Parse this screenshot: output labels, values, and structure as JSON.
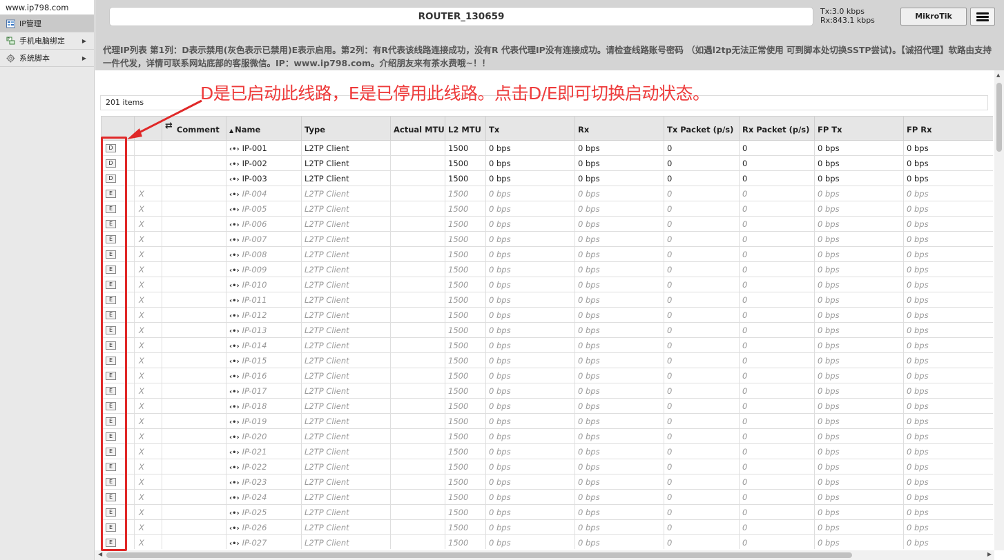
{
  "sidebar": {
    "site": "www.ip798.com",
    "items": [
      {
        "label": "IP管理",
        "icon": "ip-manage-icon",
        "active": true
      },
      {
        "label": "手机电脑绑定",
        "icon": "device-bind-icon",
        "arrow": "▶"
      },
      {
        "label": "系统脚本",
        "icon": "script-gear-icon",
        "arrow": "▶"
      }
    ]
  },
  "header": {
    "title": "ROUTER_130659",
    "tx": "Tx:3.0 kbps",
    "rx": "Rx:843.1 kbps",
    "brand_button": "MikroTik"
  },
  "notice": "代理IP列表 第1列：D表示禁用(灰色表示已禁用)E表示启用。第2列：有R代表该线路连接成功，没有R 代表代理IP没有连接成功。请检查线路账号密码 （如遇l2tp无法正常使用 可到脚本处切换SSTP尝试)。【诚招代理】软路由支持一件代发，详情可联系网站底部的客服微信。IP：www.ip798.com。介绍朋友来有茶水费哦~！！",
  "items_count": "201 items",
  "annotation": "D是已启动此线路，E是已停用此线路。点击D/E即可切换启动状态。",
  "colors": {
    "annotation": "#ee3b3b",
    "highlight_box": "#e02828"
  },
  "table": {
    "headers": {
      "toggle": "",
      "status": "",
      "comment": "Comment",
      "name": "Name",
      "type": "Type",
      "actual_mtu": "Actual MTU",
      "l2_mtu": "L2 MTU",
      "tx": "Tx",
      "rx": "Rx",
      "tx_packet": "Tx Packet (p/s)",
      "rx_packet": "Rx Packet (p/s)",
      "fp_tx": "FP Tx",
      "fp_rx": "FP Rx"
    },
    "sort_indicator": "▲",
    "comment_icon": "comment-toggle-icon",
    "rows": [
      {
        "toggle": "D",
        "status": "",
        "comment": "",
        "name": "IP-001",
        "type": "L2TP Client",
        "actual_mtu": "",
        "l2_mtu": "1500",
        "tx": "0 bps",
        "rx": "0 bps",
        "tx_packet": "0",
        "rx_packet": "0",
        "fp_tx": "0 bps",
        "fp_rx": "0 bps",
        "disabled": false
      },
      {
        "toggle": "D",
        "status": "",
        "comment": "",
        "name": "IP-002",
        "type": "L2TP Client",
        "actual_mtu": "",
        "l2_mtu": "1500",
        "tx": "0 bps",
        "rx": "0 bps",
        "tx_packet": "0",
        "rx_packet": "0",
        "fp_tx": "0 bps",
        "fp_rx": "0 bps",
        "disabled": false
      },
      {
        "toggle": "D",
        "status": "",
        "comment": "",
        "name": "IP-003",
        "type": "L2TP Client",
        "actual_mtu": "",
        "l2_mtu": "1500",
        "tx": "0 bps",
        "rx": "0 bps",
        "tx_packet": "0",
        "rx_packet": "0",
        "fp_tx": "0 bps",
        "fp_rx": "0 bps",
        "disabled": false
      },
      {
        "toggle": "E",
        "status": "X",
        "comment": "",
        "name": "IP-004",
        "type": "L2TP Client",
        "actual_mtu": "",
        "l2_mtu": "1500",
        "tx": "0 bps",
        "rx": "0 bps",
        "tx_packet": "0",
        "rx_packet": "0",
        "fp_tx": "0 bps",
        "fp_rx": "0 bps",
        "disabled": true
      },
      {
        "toggle": "E",
        "status": "X",
        "comment": "",
        "name": "IP-005",
        "type": "L2TP Client",
        "actual_mtu": "",
        "l2_mtu": "1500",
        "tx": "0 bps",
        "rx": "0 bps",
        "tx_packet": "0",
        "rx_packet": "0",
        "fp_tx": "0 bps",
        "fp_rx": "0 bps",
        "disabled": true
      },
      {
        "toggle": "E",
        "status": "X",
        "comment": "",
        "name": "IP-006",
        "type": "L2TP Client",
        "actual_mtu": "",
        "l2_mtu": "1500",
        "tx": "0 bps",
        "rx": "0 bps",
        "tx_packet": "0",
        "rx_packet": "0",
        "fp_tx": "0 bps",
        "fp_rx": "0 bps",
        "disabled": true
      },
      {
        "toggle": "E",
        "status": "X",
        "comment": "",
        "name": "IP-007",
        "type": "L2TP Client",
        "actual_mtu": "",
        "l2_mtu": "1500",
        "tx": "0 bps",
        "rx": "0 bps",
        "tx_packet": "0",
        "rx_packet": "0",
        "fp_tx": "0 bps",
        "fp_rx": "0 bps",
        "disabled": true
      },
      {
        "toggle": "E",
        "status": "X",
        "comment": "",
        "name": "IP-008",
        "type": "L2TP Client",
        "actual_mtu": "",
        "l2_mtu": "1500",
        "tx": "0 bps",
        "rx": "0 bps",
        "tx_packet": "0",
        "rx_packet": "0",
        "fp_tx": "0 bps",
        "fp_rx": "0 bps",
        "disabled": true
      },
      {
        "toggle": "E",
        "status": "X",
        "comment": "",
        "name": "IP-009",
        "type": "L2TP Client",
        "actual_mtu": "",
        "l2_mtu": "1500",
        "tx": "0 bps",
        "rx": "0 bps",
        "tx_packet": "0",
        "rx_packet": "0",
        "fp_tx": "0 bps",
        "fp_rx": "0 bps",
        "disabled": true
      },
      {
        "toggle": "E",
        "status": "X",
        "comment": "",
        "name": "IP-010",
        "type": "L2TP Client",
        "actual_mtu": "",
        "l2_mtu": "1500",
        "tx": "0 bps",
        "rx": "0 bps",
        "tx_packet": "0",
        "rx_packet": "0",
        "fp_tx": "0 bps",
        "fp_rx": "0 bps",
        "disabled": true
      },
      {
        "toggle": "E",
        "status": "X",
        "comment": "",
        "name": "IP-011",
        "type": "L2TP Client",
        "actual_mtu": "",
        "l2_mtu": "1500",
        "tx": "0 bps",
        "rx": "0 bps",
        "tx_packet": "0",
        "rx_packet": "0",
        "fp_tx": "0 bps",
        "fp_rx": "0 bps",
        "disabled": true
      },
      {
        "toggle": "E",
        "status": "X",
        "comment": "",
        "name": "IP-012",
        "type": "L2TP Client",
        "actual_mtu": "",
        "l2_mtu": "1500",
        "tx": "0 bps",
        "rx": "0 bps",
        "tx_packet": "0",
        "rx_packet": "0",
        "fp_tx": "0 bps",
        "fp_rx": "0 bps",
        "disabled": true
      },
      {
        "toggle": "E",
        "status": "X",
        "comment": "",
        "name": "IP-013",
        "type": "L2TP Client",
        "actual_mtu": "",
        "l2_mtu": "1500",
        "tx": "0 bps",
        "rx": "0 bps",
        "tx_packet": "0",
        "rx_packet": "0",
        "fp_tx": "0 bps",
        "fp_rx": "0 bps",
        "disabled": true
      },
      {
        "toggle": "E",
        "status": "X",
        "comment": "",
        "name": "IP-014",
        "type": "L2TP Client",
        "actual_mtu": "",
        "l2_mtu": "1500",
        "tx": "0 bps",
        "rx": "0 bps",
        "tx_packet": "0",
        "rx_packet": "0",
        "fp_tx": "0 bps",
        "fp_rx": "0 bps",
        "disabled": true
      },
      {
        "toggle": "E",
        "status": "X",
        "comment": "",
        "name": "IP-015",
        "type": "L2TP Client",
        "actual_mtu": "",
        "l2_mtu": "1500",
        "tx": "0 bps",
        "rx": "0 bps",
        "tx_packet": "0",
        "rx_packet": "0",
        "fp_tx": "0 bps",
        "fp_rx": "0 bps",
        "disabled": true
      },
      {
        "toggle": "E",
        "status": "X",
        "comment": "",
        "name": "IP-016",
        "type": "L2TP Client",
        "actual_mtu": "",
        "l2_mtu": "1500",
        "tx": "0 bps",
        "rx": "0 bps",
        "tx_packet": "0",
        "rx_packet": "0",
        "fp_tx": "0 bps",
        "fp_rx": "0 bps",
        "disabled": true
      },
      {
        "toggle": "E",
        "status": "X",
        "comment": "",
        "name": "IP-017",
        "type": "L2TP Client",
        "actual_mtu": "",
        "l2_mtu": "1500",
        "tx": "0 bps",
        "rx": "0 bps",
        "tx_packet": "0",
        "rx_packet": "0",
        "fp_tx": "0 bps",
        "fp_rx": "0 bps",
        "disabled": true
      },
      {
        "toggle": "E",
        "status": "X",
        "comment": "",
        "name": "IP-018",
        "type": "L2TP Client",
        "actual_mtu": "",
        "l2_mtu": "1500",
        "tx": "0 bps",
        "rx": "0 bps",
        "tx_packet": "0",
        "rx_packet": "0",
        "fp_tx": "0 bps",
        "fp_rx": "0 bps",
        "disabled": true
      },
      {
        "toggle": "E",
        "status": "X",
        "comment": "",
        "name": "IP-019",
        "type": "L2TP Client",
        "actual_mtu": "",
        "l2_mtu": "1500",
        "tx": "0 bps",
        "rx": "0 bps",
        "tx_packet": "0",
        "rx_packet": "0",
        "fp_tx": "0 bps",
        "fp_rx": "0 bps",
        "disabled": true
      },
      {
        "toggle": "E",
        "status": "X",
        "comment": "",
        "name": "IP-020",
        "type": "L2TP Client",
        "actual_mtu": "",
        "l2_mtu": "1500",
        "tx": "0 bps",
        "rx": "0 bps",
        "tx_packet": "0",
        "rx_packet": "0",
        "fp_tx": "0 bps",
        "fp_rx": "0 bps",
        "disabled": true
      },
      {
        "toggle": "E",
        "status": "X",
        "comment": "",
        "name": "IP-021",
        "type": "L2TP Client",
        "actual_mtu": "",
        "l2_mtu": "1500",
        "tx": "0 bps",
        "rx": "0 bps",
        "tx_packet": "0",
        "rx_packet": "0",
        "fp_tx": "0 bps",
        "fp_rx": "0 bps",
        "disabled": true
      },
      {
        "toggle": "E",
        "status": "X",
        "comment": "",
        "name": "IP-022",
        "type": "L2TP Client",
        "actual_mtu": "",
        "l2_mtu": "1500",
        "tx": "0 bps",
        "rx": "0 bps",
        "tx_packet": "0",
        "rx_packet": "0",
        "fp_tx": "0 bps",
        "fp_rx": "0 bps",
        "disabled": true
      },
      {
        "toggle": "E",
        "status": "X",
        "comment": "",
        "name": "IP-023",
        "type": "L2TP Client",
        "actual_mtu": "",
        "l2_mtu": "1500",
        "tx": "0 bps",
        "rx": "0 bps",
        "tx_packet": "0",
        "rx_packet": "0",
        "fp_tx": "0 bps",
        "fp_rx": "0 bps",
        "disabled": true
      },
      {
        "toggle": "E",
        "status": "X",
        "comment": "",
        "name": "IP-024",
        "type": "L2TP Client",
        "actual_mtu": "",
        "l2_mtu": "1500",
        "tx": "0 bps",
        "rx": "0 bps",
        "tx_packet": "0",
        "rx_packet": "0",
        "fp_tx": "0 bps",
        "fp_rx": "0 bps",
        "disabled": true
      },
      {
        "toggle": "E",
        "status": "X",
        "comment": "",
        "name": "IP-025",
        "type": "L2TP Client",
        "actual_mtu": "",
        "l2_mtu": "1500",
        "tx": "0 bps",
        "rx": "0 bps",
        "tx_packet": "0",
        "rx_packet": "0",
        "fp_tx": "0 bps",
        "fp_rx": "0 bps",
        "disabled": true
      },
      {
        "toggle": "E",
        "status": "X",
        "comment": "",
        "name": "IP-026",
        "type": "L2TP Client",
        "actual_mtu": "",
        "l2_mtu": "1500",
        "tx": "0 bps",
        "rx": "0 bps",
        "tx_packet": "0",
        "rx_packet": "0",
        "fp_tx": "0 bps",
        "fp_rx": "0 bps",
        "disabled": true
      },
      {
        "toggle": "E",
        "status": "X",
        "comment": "",
        "name": "IP-027",
        "type": "L2TP Client",
        "actual_mtu": "",
        "l2_mtu": "1500",
        "tx": "0 bps",
        "rx": "0 bps",
        "tx_packet": "0",
        "rx_packet": "0",
        "fp_tx": "0 bps",
        "fp_rx": "0 bps",
        "disabled": true
      }
    ]
  }
}
